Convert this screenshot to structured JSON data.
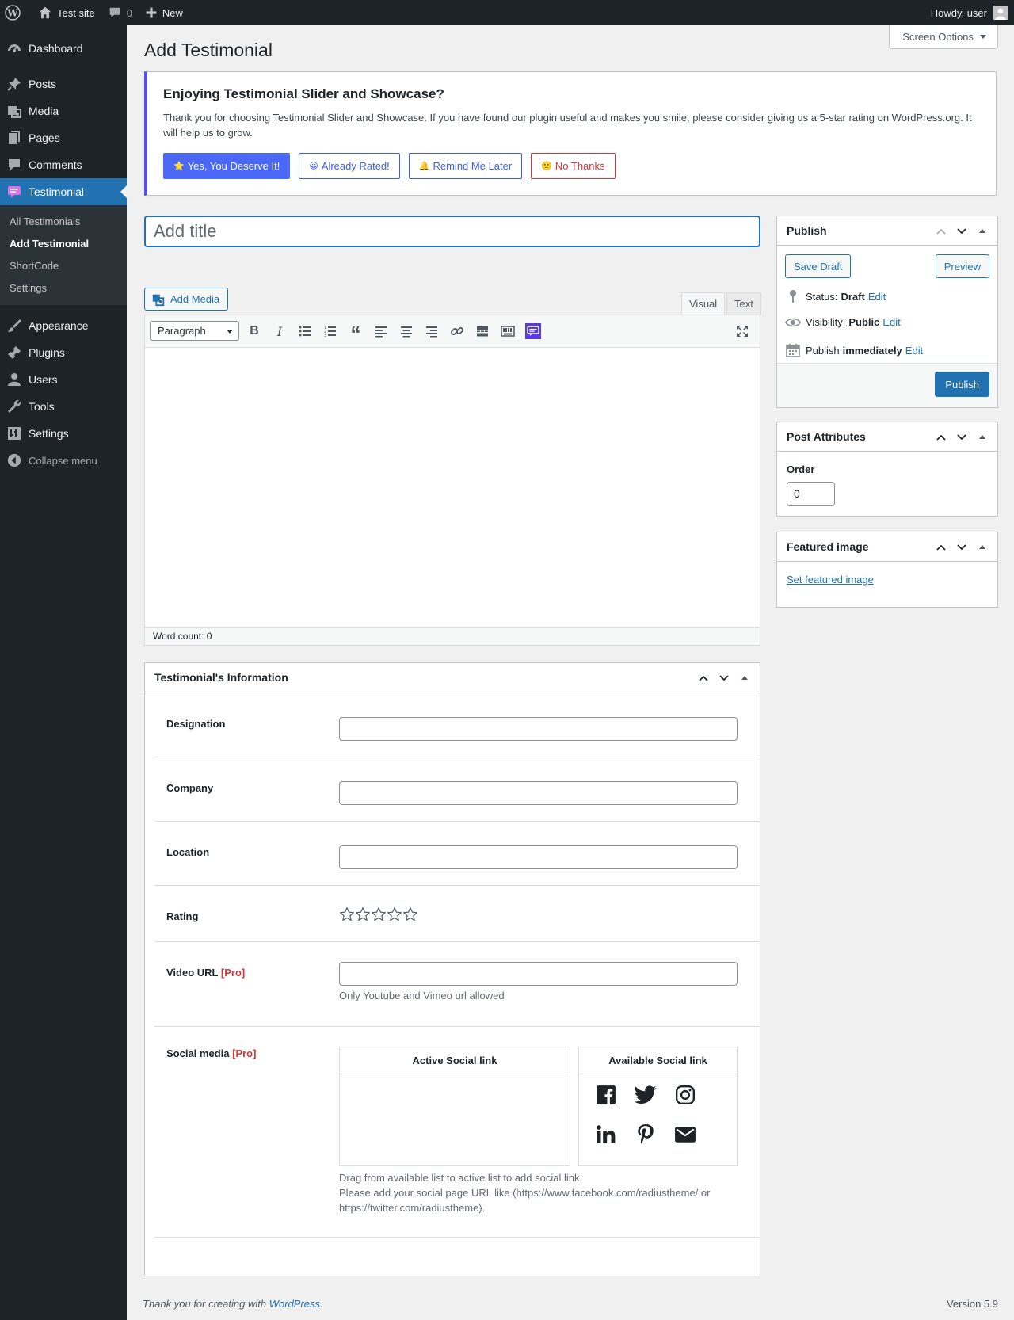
{
  "admin_bar": {
    "site_name": "Test site",
    "comments_count": "0",
    "new_label": "New",
    "howdy": "Howdy, user"
  },
  "sidebar": {
    "items": [
      {
        "label": "Dashboard",
        "icon": "dashboard-icon"
      },
      {
        "label": "Posts",
        "icon": "pin-icon"
      },
      {
        "label": "Media",
        "icon": "media-icon"
      },
      {
        "label": "Pages",
        "icon": "pages-icon"
      },
      {
        "label": "Comments",
        "icon": "comment-icon"
      },
      {
        "label": "Testimonial",
        "icon": "testimonial-icon"
      },
      {
        "label": "Appearance",
        "icon": "brush-icon"
      },
      {
        "label": "Plugins",
        "icon": "plug-icon"
      },
      {
        "label": "Users",
        "icon": "user-icon"
      },
      {
        "label": "Tools",
        "icon": "wrench-icon"
      },
      {
        "label": "Settings",
        "icon": "settings-icon"
      }
    ],
    "submenu": [
      "All Testimonials",
      "Add Testimonial",
      "ShortCode",
      "Settings"
    ],
    "collapse": "Collapse menu"
  },
  "screen_options": "Screen Options",
  "page_title": "Add Testimonial",
  "notice": {
    "title": "Enjoying Testimonial Slider and Showcase?",
    "text": "Thank you for choosing Testimonial Slider and Showcase. If you have found our plugin useful and makes you smile, please consider giving us a 5-star rating on WordPress.org. It will help us to grow.",
    "btn_yes": "Yes, You Deserve It!",
    "btn_rated": "Already Rated!",
    "btn_later": "Remind Me Later",
    "btn_no": "No Thanks"
  },
  "title_placeholder": "Add title",
  "editor": {
    "add_media": "Add Media",
    "tab_visual": "Visual",
    "tab_text": "Text",
    "format": "Paragraph",
    "word_count": "Word count: 0"
  },
  "publish": {
    "title": "Publish",
    "save_draft": "Save Draft",
    "preview": "Preview",
    "status_label": "Status:",
    "status_value": "Draft",
    "visibility_label": "Visibility:",
    "visibility_value": "Public",
    "publish_label": "Publish",
    "publish_value": "immediately",
    "edit": "Edit",
    "publish_button": "Publish"
  },
  "post_attributes": {
    "title": "Post Attributes",
    "order_label": "Order",
    "order_value": "0"
  },
  "featured_image": {
    "title": "Featured image",
    "link": "Set featured image"
  },
  "testimonial_info": {
    "title": "Testimonial's Information",
    "designation": "Designation",
    "company": "Company",
    "location": "Location",
    "rating": "Rating",
    "rating_value": 0,
    "rating_max": 5,
    "video_url": "Video URL",
    "pro": "[Pro]",
    "video_desc": "Only Youtube and Vimeo url allowed",
    "social_media": "Social media",
    "active_social": "Active Social link",
    "available_social": "Available Social link",
    "social_icons": [
      "facebook-icon",
      "twitter-icon",
      "instagram-icon",
      "linkedin-icon",
      "pinterest-icon",
      "email-icon"
    ],
    "social_desc_1": "Drag from available list to active list to add social link.",
    "social_desc_2": "Please add your social page URL like (https://www.facebook.com/radiustheme/ or",
    "social_desc_3": "https://twitter.com/radiustheme)."
  },
  "footer": {
    "thanks_prefix": "Thank you for creating with",
    "wordpress": "WordPress",
    "period": ".",
    "version": "Version 5.9"
  },
  "colors": {
    "admin_dark": "#1d2327",
    "accent_blue": "#2271b1",
    "notice_border": "#5a4fdc",
    "pro_red": "#d63638"
  }
}
